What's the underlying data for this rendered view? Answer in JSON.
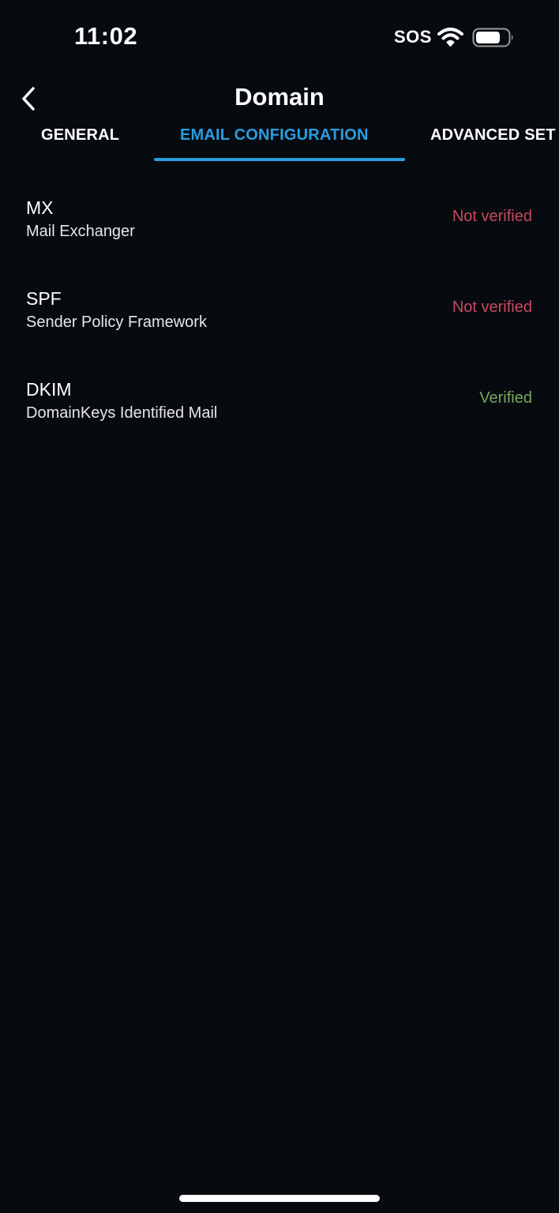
{
  "status_bar": {
    "time": "11:02",
    "sos": "SOS",
    "wifi_icon": "wifi-icon",
    "battery_icon": "battery-icon"
  },
  "nav": {
    "back_icon": "chevron-left-icon",
    "title": "Domain"
  },
  "tabs": [
    {
      "label": "GENERAL",
      "active": false
    },
    {
      "label": "EMAIL CONFIGURATION",
      "active": true
    },
    {
      "label": "ADVANCED SET",
      "active": false
    }
  ],
  "records": [
    {
      "title": "MX",
      "subtitle": "Mail Exchanger",
      "status": "Not verified"
    },
    {
      "title": "SPF",
      "subtitle": "Sender Policy Framework",
      "status": "Not verified"
    },
    {
      "title": "DKIM",
      "subtitle": "DomainKeys Identified Mail",
      "status": "Verified"
    }
  ],
  "colors": {
    "background": "#070b10",
    "accent": "#2a9de2",
    "not_verified": "#c9485f",
    "verified": "#76a75a"
  }
}
